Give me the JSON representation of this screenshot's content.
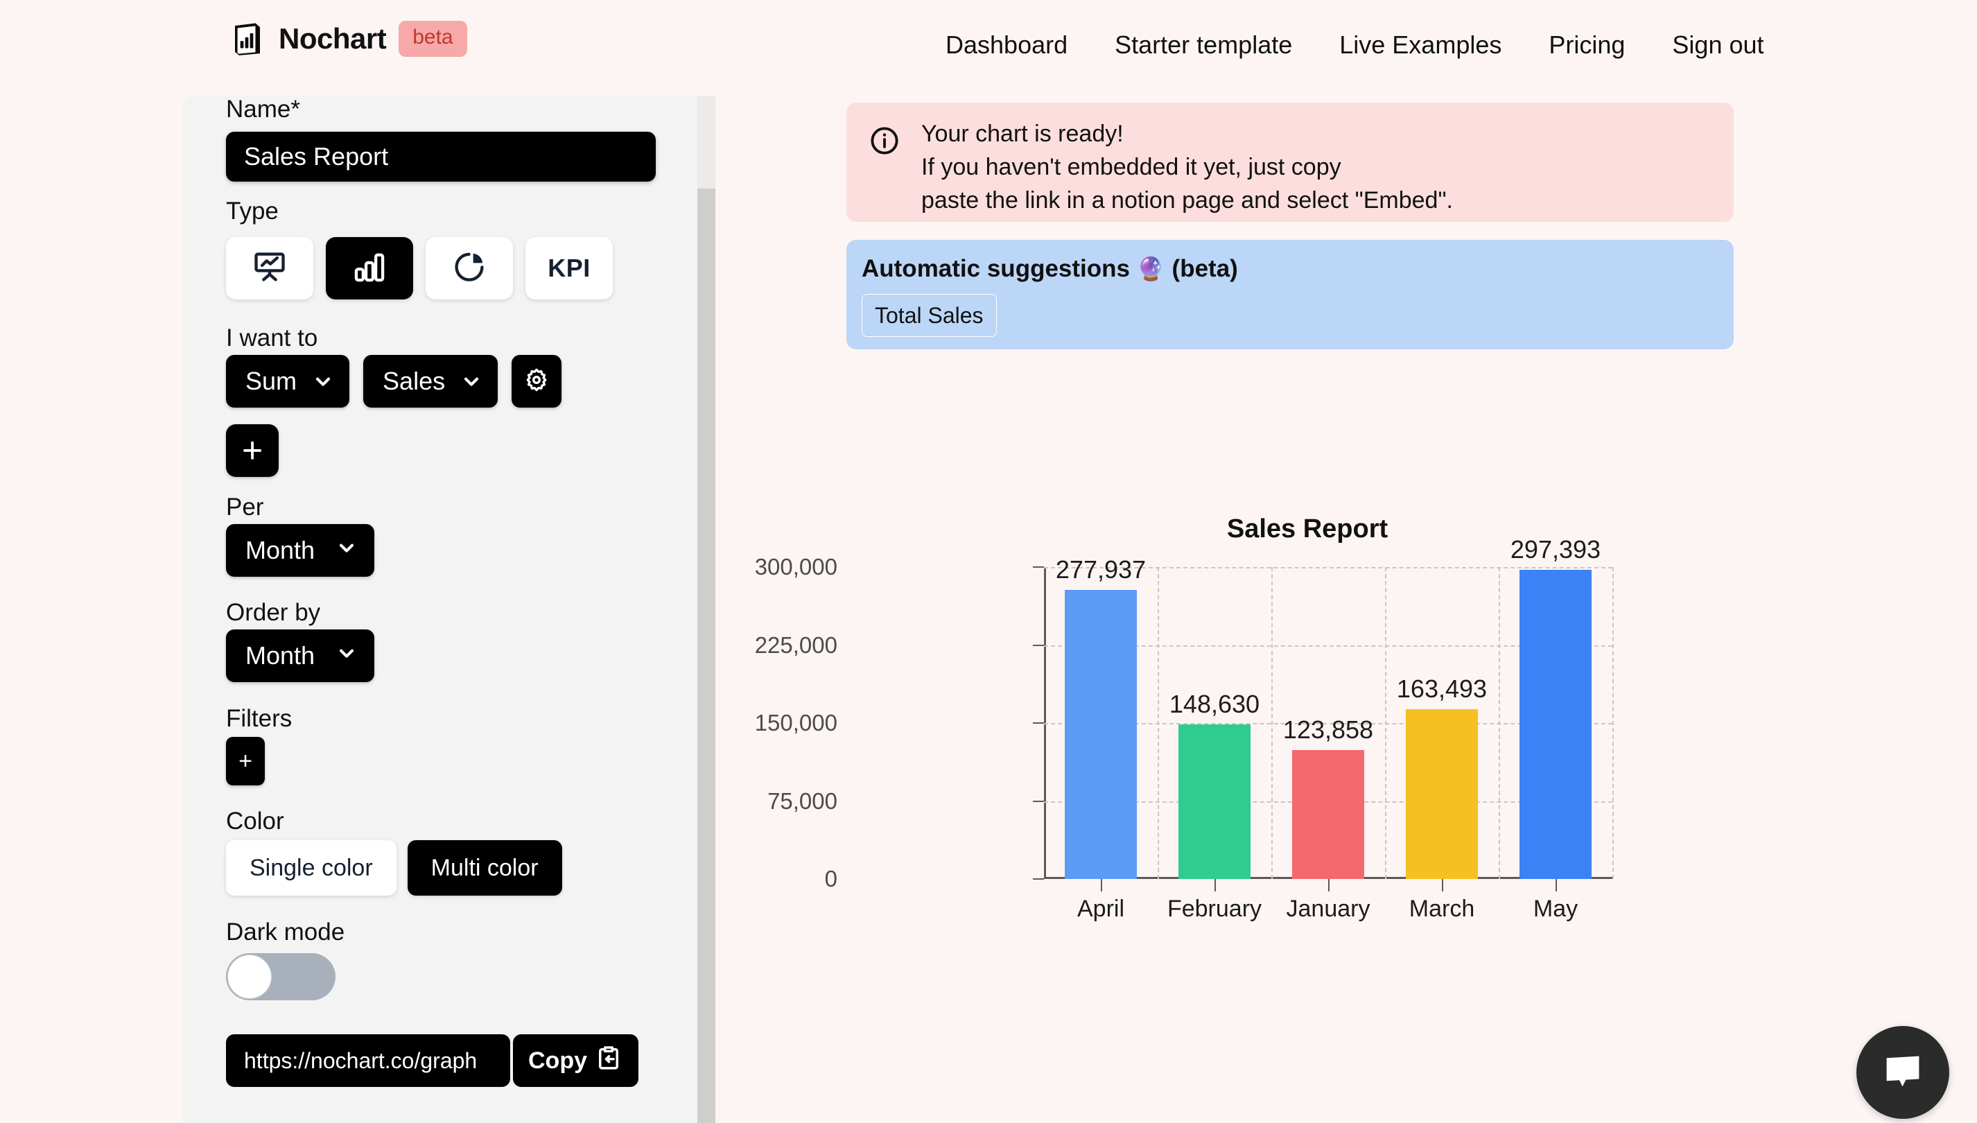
{
  "brand": {
    "name": "Nochart",
    "badge": "beta",
    "logo_icon": "notebook-bar-chart-icon"
  },
  "nav": [
    {
      "label": "Dashboard"
    },
    {
      "label": "Starter template"
    },
    {
      "label": "Live Examples"
    },
    {
      "label": "Pricing"
    },
    {
      "label": "Sign out"
    }
  ],
  "sidebar": {
    "name": {
      "label": "Name*",
      "value": "Sales Report",
      "placeholder": "Name"
    },
    "type": {
      "label": "Type",
      "options": [
        {
          "icon": "presentation-line-chart-icon",
          "label": "",
          "selected": false
        },
        {
          "icon": "bar-chart-icon",
          "label": "",
          "selected": true
        },
        {
          "icon": "pie-chart-icon",
          "label": "",
          "selected": false
        },
        {
          "icon": "kpi-icon",
          "label": "KPI",
          "selected": false
        }
      ]
    },
    "want_to": {
      "label": "I want to",
      "aggregate": "Sum",
      "field": "Sales",
      "settings_icon": "gear-icon",
      "add_icon": "plus-icon"
    },
    "per": {
      "label": "Per",
      "value": "Month"
    },
    "order_by": {
      "label": "Order by",
      "value": "Month"
    },
    "filters": {
      "label": "Filters",
      "add_label": "+"
    },
    "color": {
      "label": "Color",
      "options": [
        {
          "label": "Single color",
          "selected": false
        },
        {
          "label": "Multi color",
          "selected": true
        }
      ]
    },
    "dark_mode": {
      "label": "Dark mode",
      "enabled": false
    },
    "share": {
      "url": "https://nochart.co/graph",
      "copy_label": "Copy",
      "copy_icon": "clipboard-paste-icon"
    }
  },
  "alert": {
    "icon": "info-circle-icon",
    "lines": [
      "Your chart is ready!",
      "If you haven't embedded it yet, just copy",
      "paste the link in a notion page and select \"Embed\"."
    ]
  },
  "suggestions": {
    "title": "Automatic suggestions",
    "emoji": "🔮",
    "beta": "(beta)",
    "chips": [
      {
        "label": "Total Sales"
      }
    ]
  },
  "chat": {
    "icon": "chat-bubble-icon"
  },
  "chart_data": {
    "type": "bar",
    "title": "Sales Report",
    "xlabel": "",
    "ylabel": "",
    "categories": [
      "April",
      "February",
      "January",
      "March",
      "May"
    ],
    "values": [
      277937,
      148630,
      123858,
      163493,
      297393
    ],
    "value_labels": [
      "277,937",
      "148,630",
      "123,858",
      "163,493",
      "297,393"
    ],
    "colors": [
      "#5b9bf5",
      "#2ecc8f",
      "#f4696e",
      "#f7c022",
      "#3b82f6"
    ],
    "ylim": [
      0,
      300000
    ],
    "yticks": [
      0,
      75000,
      150000,
      225000,
      300000
    ],
    "ytick_labels": [
      "0",
      "75,000",
      "150,000",
      "225,000",
      "300,000"
    ],
    "grid": true,
    "legend": false
  }
}
